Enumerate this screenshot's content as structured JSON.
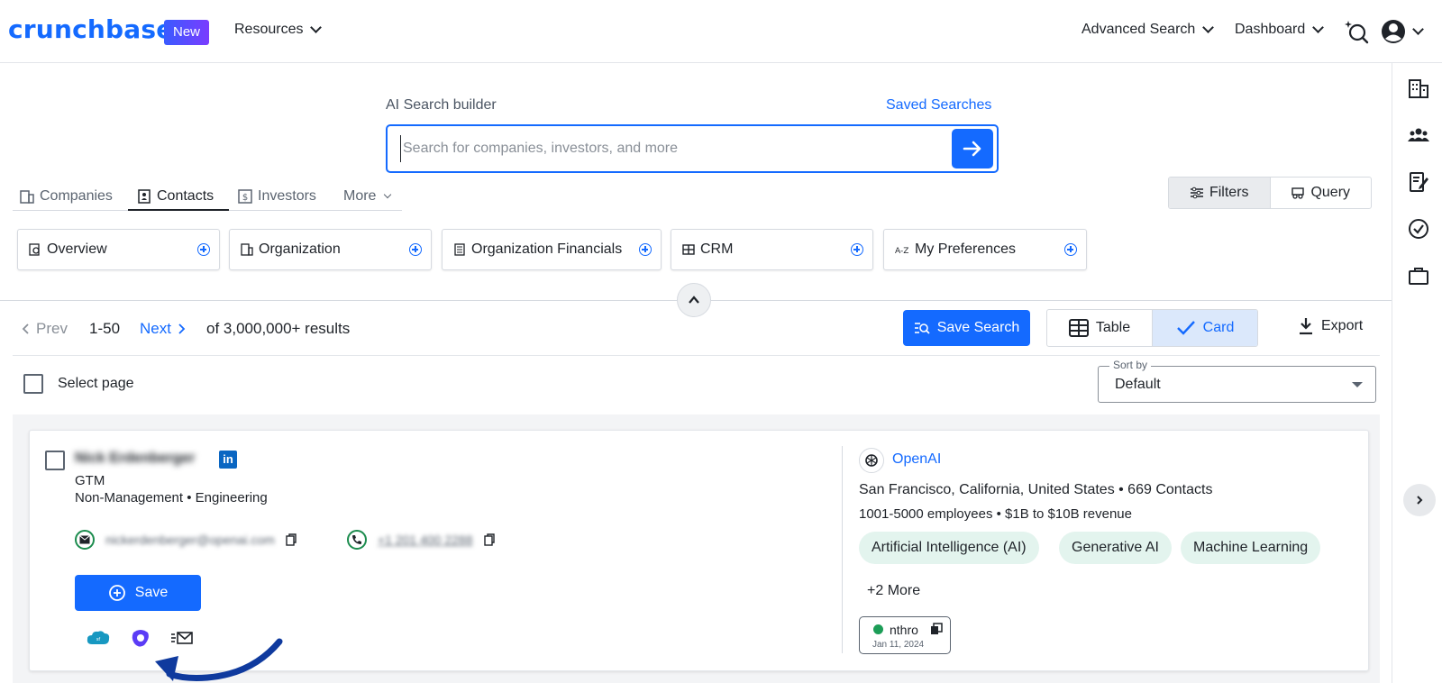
{
  "header": {
    "logo": "crunchbase",
    "new_badge": "New",
    "resources": "Resources",
    "advanced_search": "Advanced Search",
    "dashboard": "Dashboard"
  },
  "search_builder": {
    "label": "AI Search builder",
    "saved_searches": "Saved Searches",
    "placeholder": "Search for companies, investors, and more"
  },
  "tabs": [
    {
      "label": "Companies",
      "icon": "building-icon"
    },
    {
      "label": "Contacts",
      "icon": "contact-card-icon",
      "active": true
    },
    {
      "label": "Investors",
      "icon": "dollar-icon"
    },
    {
      "label": "More",
      "icon": "chevron-down-icon"
    }
  ],
  "mode_toggle": {
    "filters": "Filters",
    "query": "Query"
  },
  "filter_categories": [
    {
      "label": "Overview",
      "icon": "overview-icon"
    },
    {
      "label": "Organization",
      "icon": "building-icon"
    },
    {
      "label": "Organization Financials",
      "icon": "document-icon"
    },
    {
      "label": "CRM",
      "icon": "grid-icon"
    },
    {
      "label": "My Preferences",
      "icon": "az-icon"
    }
  ],
  "results": {
    "prev": "Prev",
    "range": "1-50",
    "next": "Next",
    "total": "of 3,000,000+ results",
    "save_search": "Save Search",
    "view_table": "Table",
    "view_card": "Card",
    "export": "Export",
    "select_page": "Select page",
    "sort_label": "Sort by",
    "sort_value": "Default"
  },
  "card": {
    "name": "Nick Erdenberger",
    "title": "GTM",
    "department": "Non-Management • Engineering",
    "email": "nickerdenberger@openai.com",
    "phone": "+1 201 400 2288",
    "save_label": "Save",
    "org": {
      "name": "OpenAI",
      "location": "San Francisco, California, United States • 669 Contacts",
      "size": "1001-5000 employees • $1B to $10B revenue",
      "tags": [
        "Artificial Intelligence (AI)",
        "Generative AI",
        "Machine Learning"
      ],
      "more": "+2 More",
      "badge_name": "nthro",
      "badge_date": "Jan 11, 2024"
    }
  },
  "colors": {
    "brand_blue": "#146aff",
    "chip_green": "#e3f4ee",
    "arrow_navy": "#0f3a9e"
  }
}
